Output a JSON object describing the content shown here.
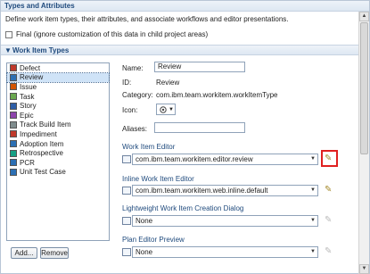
{
  "header": {
    "title": "Types and Attributes",
    "description": "Define work item types, their attributes, and associate workflows and editor presentations.",
    "final_checkbox_label": "Final (ignore customization of this data in child project areas)"
  },
  "work_item_types": {
    "section_title": "Work Item Types",
    "items": [
      {
        "label": "Defect",
        "icon_color": "#c0392b"
      },
      {
        "label": "Review",
        "icon_color": "#2c6fb3"
      },
      {
        "label": "Issue",
        "icon_color": "#d35400"
      },
      {
        "label": "Task",
        "icon_color": "#6aa84f"
      },
      {
        "label": "Story",
        "icon_color": "#2f5fa8"
      },
      {
        "label": "Epic",
        "icon_color": "#8e44ad"
      },
      {
        "label": "Track Build Item",
        "icon_color": "#7f8c8d"
      },
      {
        "label": "Impediment",
        "icon_color": "#c0392b"
      },
      {
        "label": "Adoption Item",
        "icon_color": "#2c6fb3"
      },
      {
        "label": "Retrospective",
        "icon_color": "#16a085"
      },
      {
        "label": "PCR",
        "icon_color": "#2c6fb3"
      },
      {
        "label": "Unit Test Case",
        "icon_color": "#2c6fb3"
      }
    ],
    "add_button": "Add...",
    "remove_button": "Remove"
  },
  "details": {
    "name_label": "Name:",
    "name_value": "Review",
    "id_label": "ID:",
    "id_value": "Review",
    "category_label": "Category:",
    "category_value": "com.ibm.team.workitem.workItemType",
    "icon_label": "Icon:",
    "aliases_label": "Aliases:",
    "aliases_value": ""
  },
  "editors": {
    "work_item_editor_label": "Work Item Editor",
    "work_item_editor_value": "com.ibm.team.workitem.editor.review",
    "inline_editor_label": "Inline Work Item Editor",
    "inline_editor_value": "com.ibm.team.workitem.web.inline.default",
    "lightweight_label": "Lightweight Work Item Creation Dialog",
    "lightweight_value": "None",
    "plan_preview_label": "Plan Editor Preview",
    "plan_preview_value": "None"
  }
}
